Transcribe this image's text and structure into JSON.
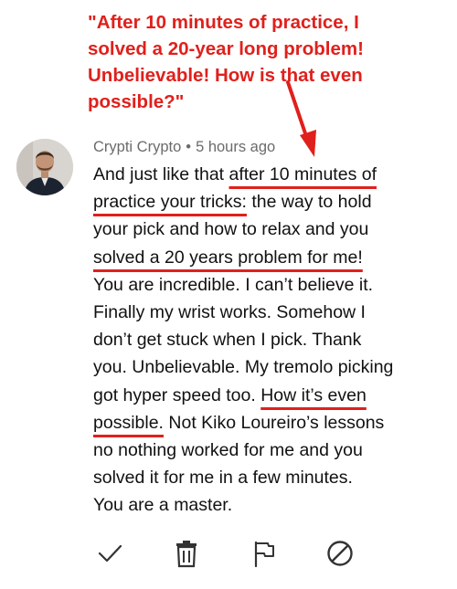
{
  "headline": {
    "lines": [
      "\"After 10 minutes of practice, I",
      "solved a 20-year long problem!",
      "Unbelievable! How is that even",
      "possible?\""
    ]
  },
  "comment": {
    "author": "Crypti Crypto",
    "separator": "•",
    "time": "5 hours ago",
    "lines": [
      {
        "pre": "And just like that ",
        "u": "after 10 minutes of",
        "post": ""
      },
      {
        "pre": "",
        "u": "practice your tricks:",
        "post": " the way to hold"
      },
      {
        "pre": "your pick and how to relax and you",
        "u": "",
        "post": ""
      },
      {
        "pre": "",
        "u": "solved a 20 years problem for me!",
        "post": ""
      },
      {
        "pre": "You are incredible. I can’t believe it.",
        "u": "",
        "post": ""
      },
      {
        "pre": "Finally my wrist works. Somehow I",
        "u": "",
        "post": ""
      },
      {
        "pre": "don’t get stuck when I pick. Thank",
        "u": "",
        "post": ""
      },
      {
        "pre": "you. Unbelievable. My tremolo picking",
        "u": "",
        "post": ""
      },
      {
        "pre": "got hyper speed too. ",
        "u": "How it’s even",
        "post": ""
      },
      {
        "pre": "",
        "u": "possible.",
        "post": " Not Kiko Loureiro’s lessons"
      },
      {
        "pre": "no nothing worked for me and you",
        "u": "",
        "post": ""
      },
      {
        "pre": "solved it for me in a few minutes.",
        "u": "",
        "post": ""
      },
      {
        "pre": "You are a master.",
        "u": "",
        "post": ""
      }
    ]
  },
  "actions": {
    "approve_icon": "checkmark-icon",
    "delete_icon": "trash-icon",
    "report_icon": "flag-icon",
    "block_icon": "block-icon"
  },
  "colors": {
    "annotation_red": "#e0201c",
    "meta_gray": "#6b6b6b",
    "text": "#111111",
    "icon": "#333333"
  }
}
